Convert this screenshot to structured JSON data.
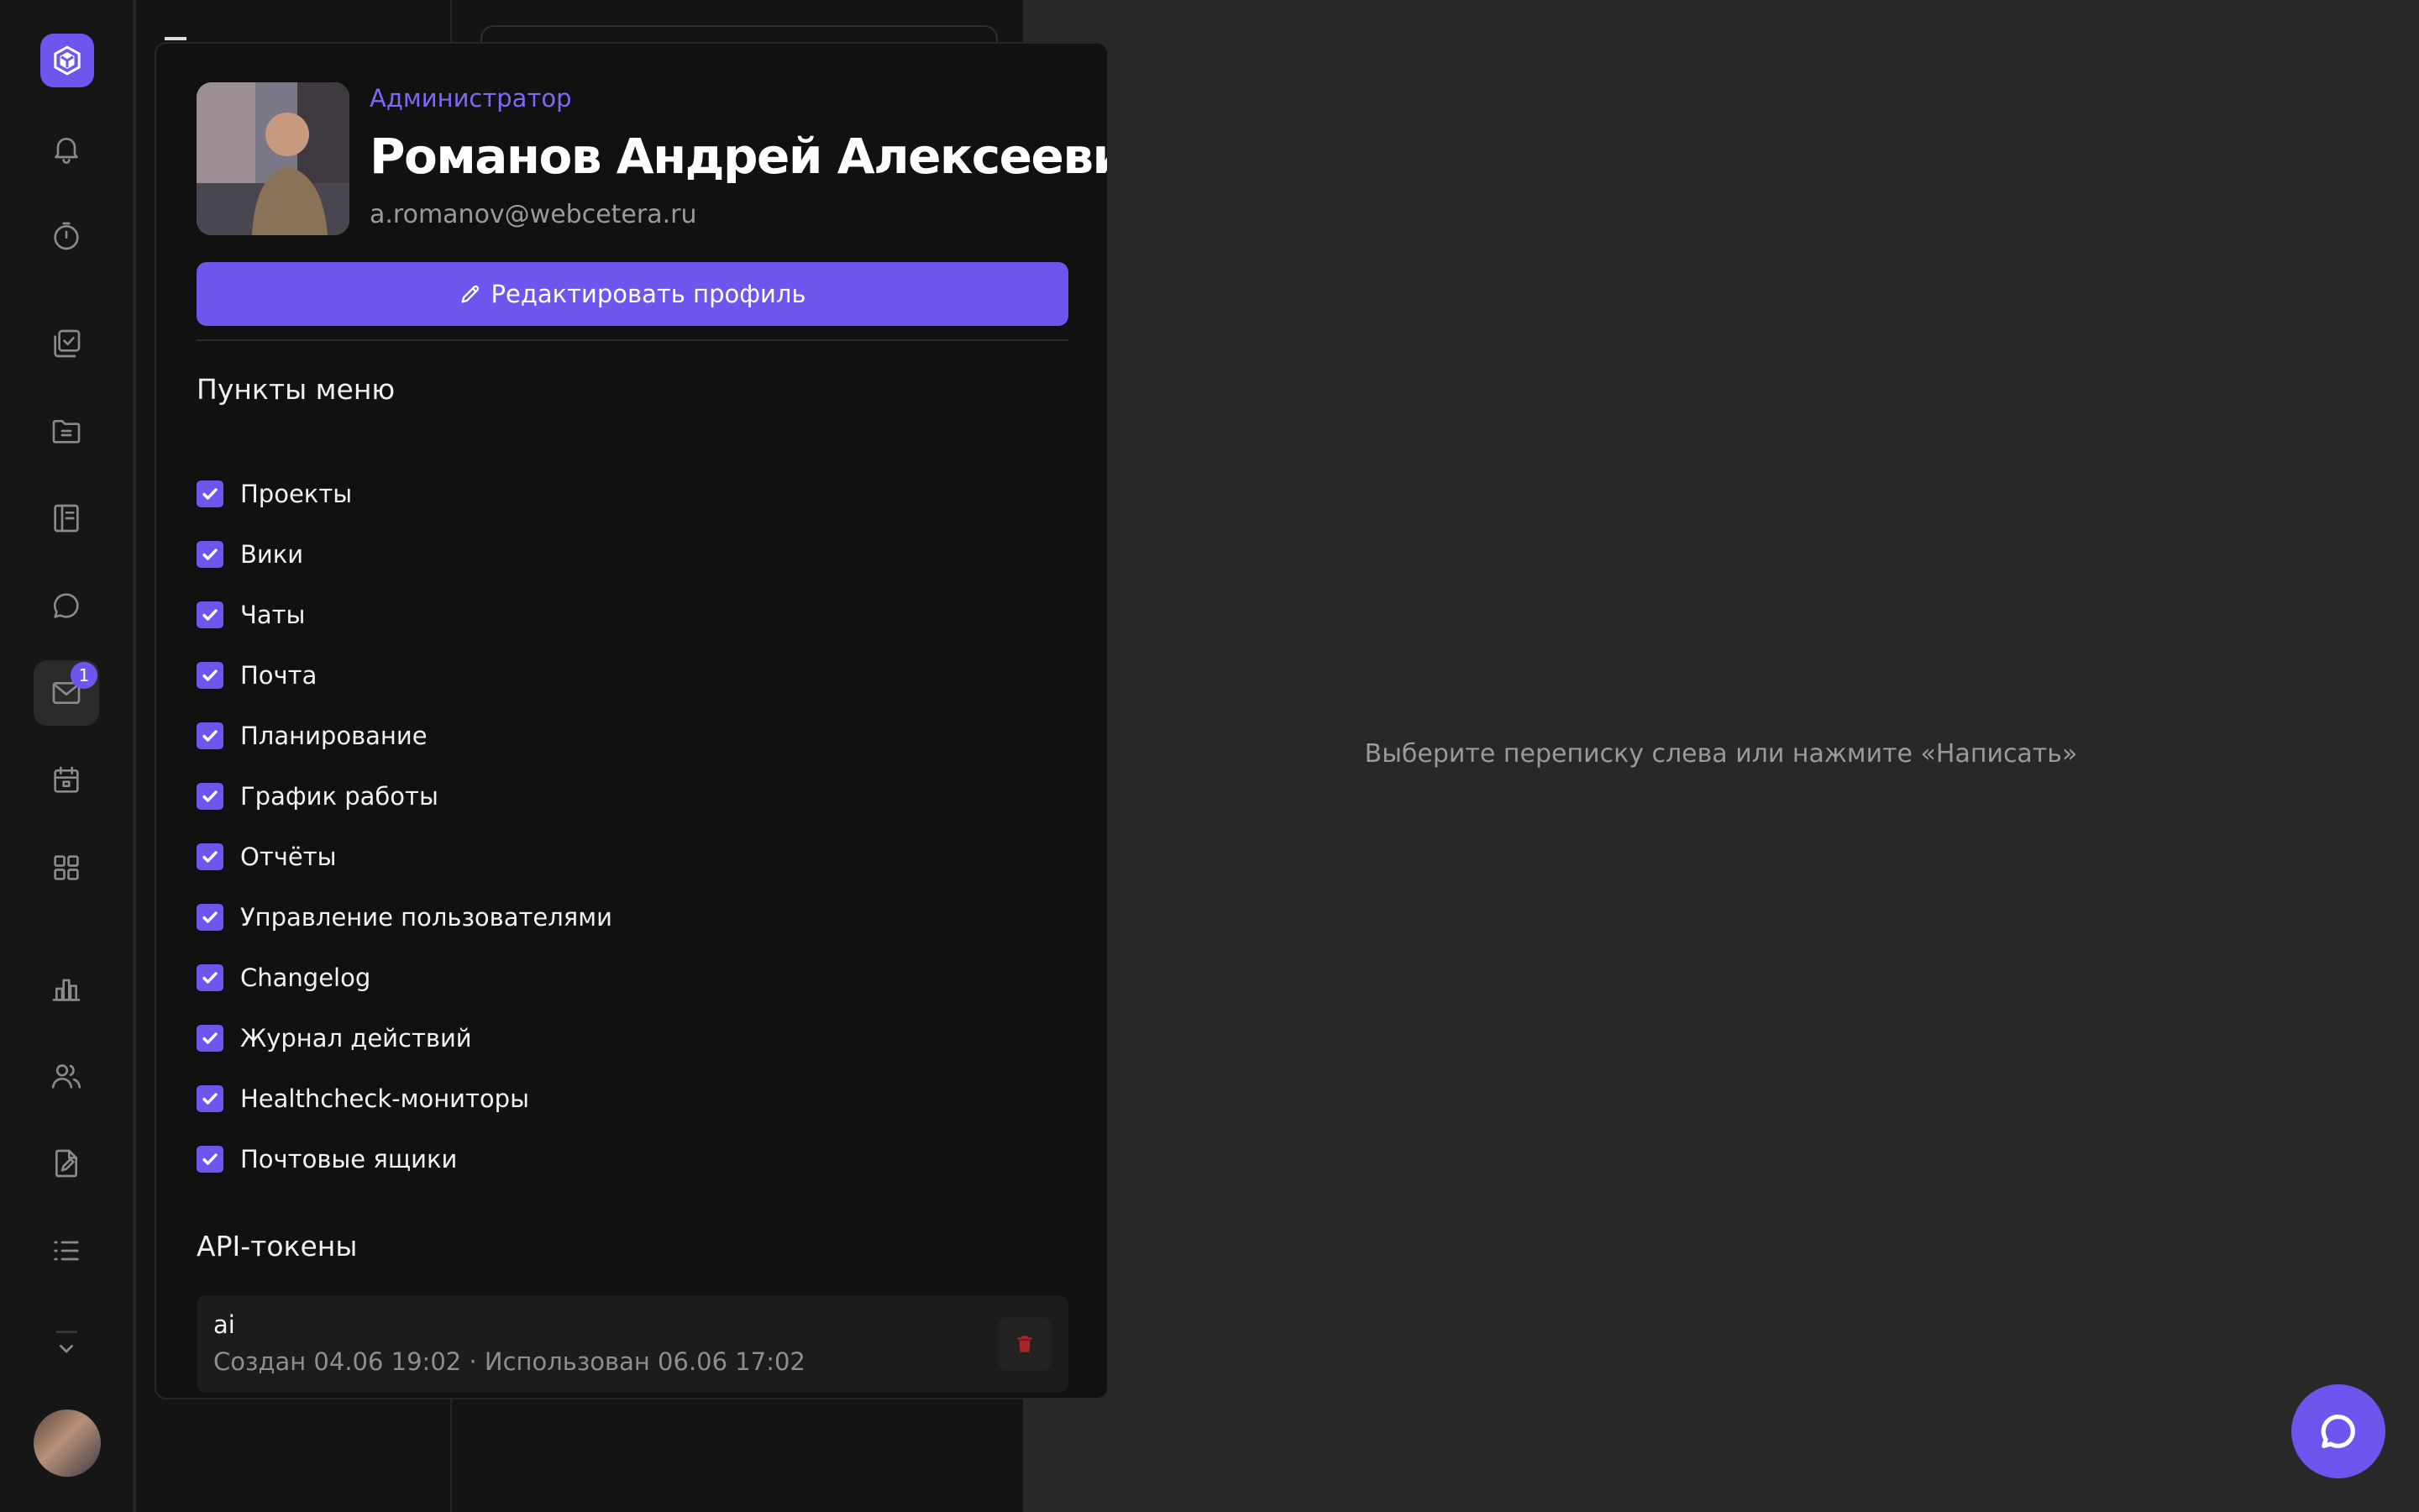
{
  "profile": {
    "role": "Администратор",
    "name": "Романов Андрей Алексеевич",
    "email": "a.romanov@webcetera.ru",
    "edit_label": "Редактировать профиль"
  },
  "menu_section": {
    "title": "Пункты меню",
    "items": [
      {
        "label": "Проекты",
        "checked": true
      },
      {
        "label": "Вики",
        "checked": true
      },
      {
        "label": "Чаты",
        "checked": true
      },
      {
        "label": "Почта",
        "checked": true
      },
      {
        "label": "Планирование",
        "checked": true
      },
      {
        "label": "График работы",
        "checked": true
      },
      {
        "label": "Отчёты",
        "checked": true
      },
      {
        "label": "Управление пользователями",
        "checked": true
      },
      {
        "label": "Changelog",
        "checked": true
      },
      {
        "label": "Журнал действий",
        "checked": true
      },
      {
        "label": "Healthcheck-мониторы",
        "checked": true
      },
      {
        "label": "Почтовые ящики",
        "checked": true
      }
    ]
  },
  "tokens_section": {
    "title": "API-токены",
    "tokens": [
      {
        "name": "ai",
        "meta": "Создан 04.06 19:02 · Использован 06.06 17:02"
      }
    ]
  },
  "rail": {
    "mail_badge": "1",
    "icons": [
      "logo-icon",
      "bell-icon",
      "timer-icon",
      "tasks-icon",
      "folder-icon",
      "wiki-icon",
      "chat-icon",
      "mail-icon",
      "calendar-icon",
      "apps-icon",
      "chart-icon",
      "users-icon",
      "file-edit-icon",
      "list-icon",
      "chevron-down-icon"
    ]
  },
  "main": {
    "empty_text": "Выберите переписку слева или нажмите «Написать»"
  },
  "colors": {
    "accent": "#6d55ee",
    "background": "#282828",
    "panel": "#111111",
    "danger": "#a8232a"
  }
}
